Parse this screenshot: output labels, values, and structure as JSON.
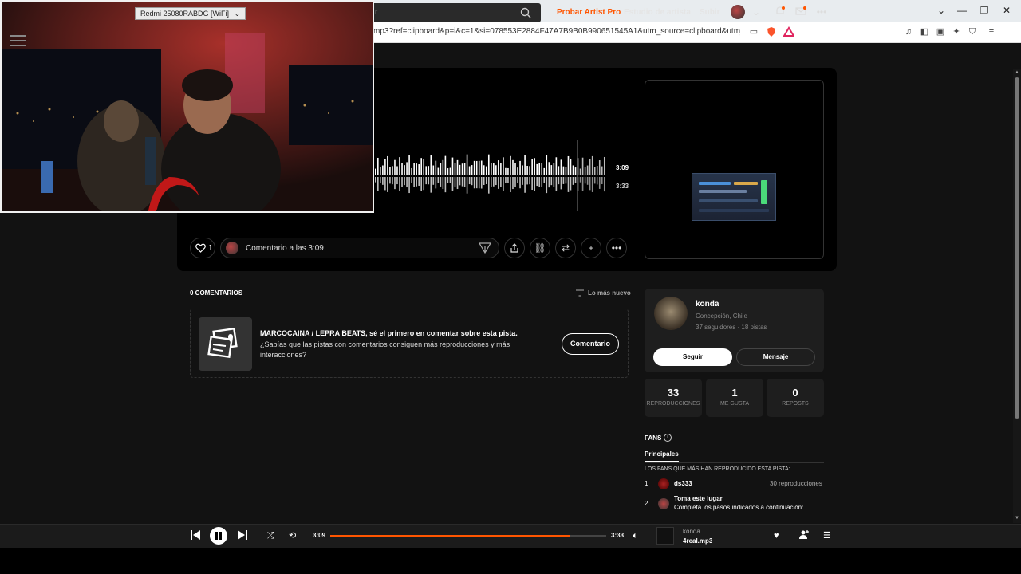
{
  "browser": {
    "url": "mp3?ref=clipboard&p=i&c=1&si=078553E2884F47A7B9B0B990651545A1&utm_source=clipboard&utm_medi...",
    "new_tab": "+",
    "close_tab": "×"
  },
  "header": {
    "search_placeholder": "r",
    "try_pro": "Probar Artist Pro",
    "studio": "Estudio de artista",
    "upload": "Subir"
  },
  "track": {
    "current_time": "3:09",
    "total_time": "3:33",
    "progress_fraction": 0.87,
    "likes": "1",
    "comment_placeholder": "Comentario a las 3:09"
  },
  "comments": {
    "header": "0 COMENTARIOS",
    "sort": "Lo más nuevo",
    "empty_title": "MARCOCAINA / LEPRA BEATS, sé el primero en comentar sobre esta pista.",
    "empty_text": "¿Sabías que las pistas con comentarios consiguen más reproducciones y más interacciones?",
    "button": "Comentario"
  },
  "artist": {
    "name": "konda",
    "location": "Concepción, Chile",
    "stats": "37 seguidores · 18 pistas",
    "follow": "Seguir",
    "message": "Mensaje"
  },
  "stats": [
    {
      "value": "33",
      "label": "REPRODUCCIONES"
    },
    {
      "value": "1",
      "label": "ME GUSTA"
    },
    {
      "value": "0",
      "label": "REPOSTS"
    }
  ],
  "fans": {
    "header": "FANS",
    "tab": "Principales",
    "subtitle": "LOS FANS QUE MÁS HAN REPRODUCIDO ESTA PISTA:",
    "list": [
      {
        "rank": "1",
        "name": "ds333",
        "plays": "30 reproducciones"
      },
      {
        "rank": "2",
        "name": "Toma este lugar",
        "sub": "Completa los pasos indicados a continuación:"
      }
    ]
  },
  "player": {
    "current_time": "3:09",
    "total_time": "3:33",
    "artist": "konda",
    "title": "4real.mp3"
  },
  "webcam": {
    "title": "Redmi 25080RABDG [WiFi]"
  },
  "colors": {
    "accent": "#ff5500",
    "background": "#121212",
    "card": "#1e1e1e"
  }
}
